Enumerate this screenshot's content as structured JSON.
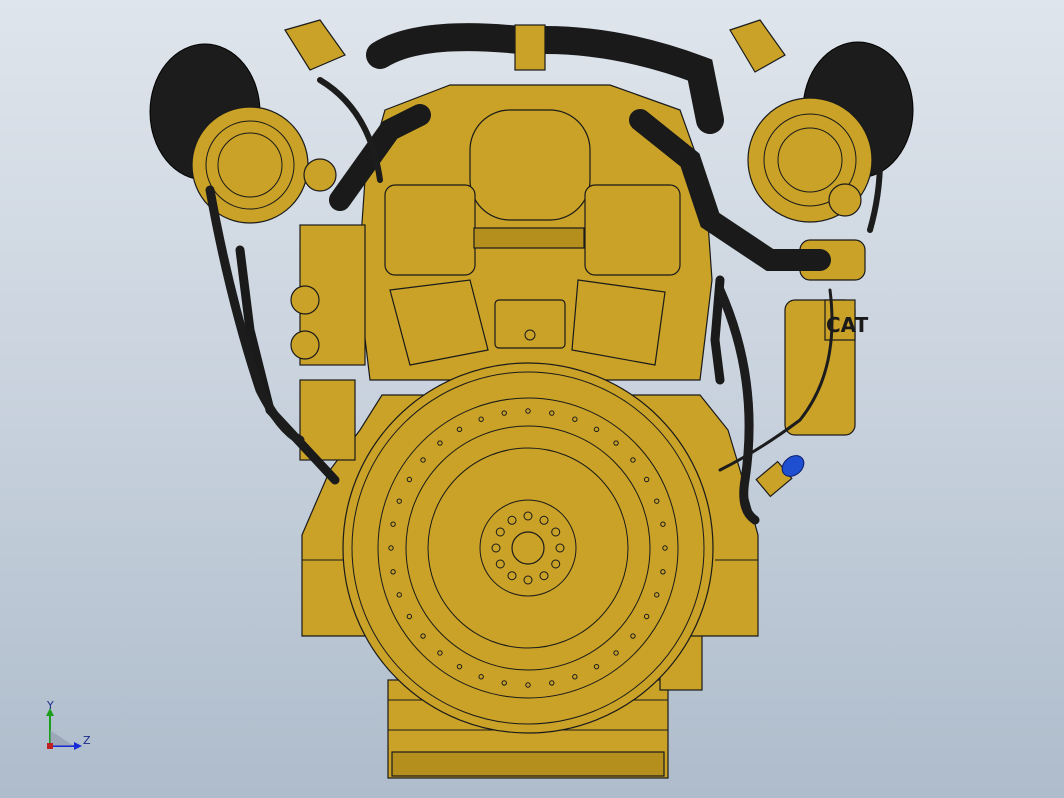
{
  "viewport": {
    "background_top": "#dfe5ec",
    "background_bottom": "#aebccb"
  },
  "model": {
    "body_color": "#c9a227",
    "edge_color": "#1a1a1a",
    "hose_color": "#1c1c1c",
    "cap_color": "#1f4fd1",
    "logo_text": "CAT"
  },
  "triad": {
    "y_label": "Y",
    "z_label": "Z",
    "y_color": "#1b9e1b",
    "z_color": "#1a2ad8"
  }
}
